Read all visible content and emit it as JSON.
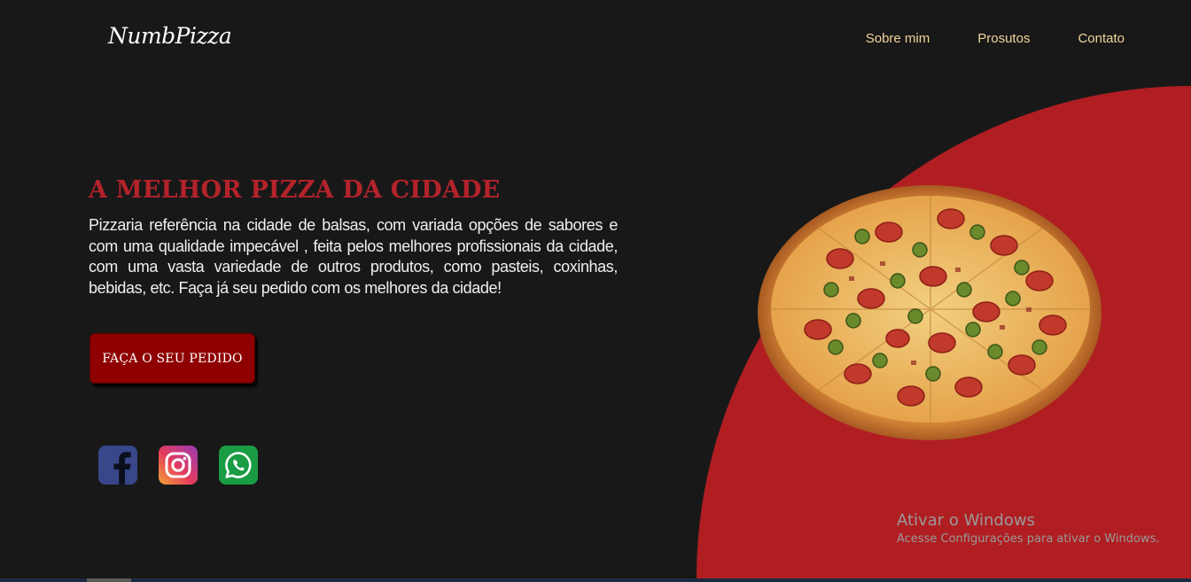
{
  "header": {
    "logo": "NumbPizza",
    "nav": [
      "Sobre mim",
      "Prosutos",
      "Contato"
    ]
  },
  "hero": {
    "title": "A MELHOR PIZZA DA CIDADE",
    "description": "Pizzaria referência na cidade de balsas, com variada opções de sabores e com uma qualidade impecável , feita pelos melhores profissionais da cidade, com uma vasta variedade de outros produtos, como pasteis, coxinhas, bebidas, etc. Faça já seu pedido com os melhores da cidade!",
    "cta_label": "FAÇA O SEU PEDIDO"
  },
  "social": [
    {
      "name": "facebook",
      "icon": "facebook-icon",
      "color": "#38478a"
    },
    {
      "name": "instagram",
      "icon": "instagram-icon",
      "color": "#e53b5c"
    },
    {
      "name": "whatsapp",
      "icon": "whatsapp-icon",
      "color": "#1a9c44"
    }
  ],
  "watermark": {
    "title": "Ativar o Windows",
    "subtitle": "Acesse Configurações para ativar o Windows."
  },
  "colors": {
    "background": "#181818",
    "accent_red": "#b01e22",
    "title_red": "#b3232a",
    "button": "#8f0000",
    "nav_text": "#f1d39a"
  },
  "image": {
    "subject": "pepperoni pizza with jalapeños and olives"
  }
}
